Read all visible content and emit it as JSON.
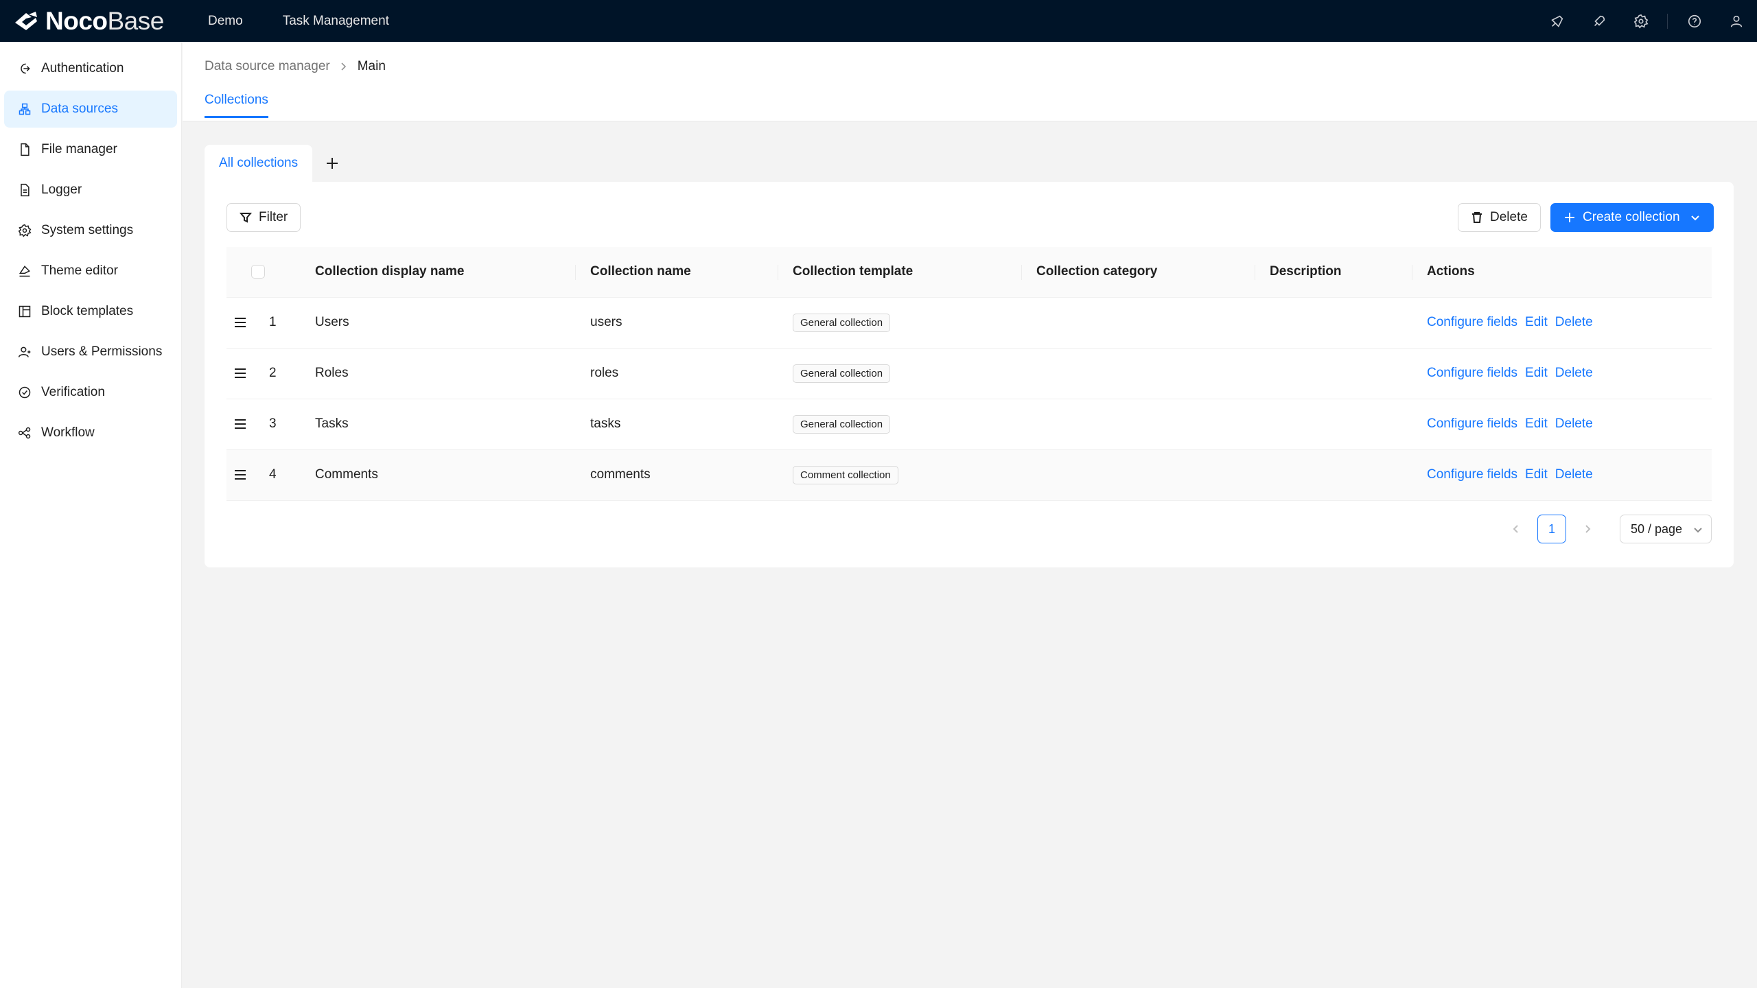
{
  "app": {
    "logo_bold": "Noco",
    "logo_light": "Base",
    "nav": [
      "Demo",
      "Task Management"
    ],
    "top_icons": [
      "brush-icon",
      "rocket-icon",
      "gear-icon",
      "help-icon",
      "user-icon"
    ]
  },
  "sidebar": {
    "items": [
      {
        "label": "Authentication",
        "icon": "login-icon"
      },
      {
        "label": "Data sources",
        "icon": "database-icon",
        "active": true
      },
      {
        "label": "File manager",
        "icon": "file-icon"
      },
      {
        "label": "Logger",
        "icon": "log-file-icon"
      },
      {
        "label": "System settings",
        "icon": "gear-icon"
      },
      {
        "label": "Theme editor",
        "icon": "paint-icon"
      },
      {
        "label": "Block templates",
        "icon": "layout-icon"
      },
      {
        "label": "Users & Permissions",
        "icon": "users-icon"
      },
      {
        "label": "Verification",
        "icon": "check-circle-icon"
      },
      {
        "label": "Workflow",
        "icon": "workflow-icon"
      }
    ]
  },
  "breadcrumb": {
    "parent": "Data source manager",
    "current": "Main"
  },
  "page_tab": "Collections",
  "collection_tabs": {
    "active": "All collections"
  },
  "toolbar": {
    "filter": "Filter",
    "delete": "Delete",
    "create": "Create collection"
  },
  "table": {
    "columns": [
      "Collection display name",
      "Collection name",
      "Collection template",
      "Collection category",
      "Description",
      "Actions"
    ],
    "rows": [
      {
        "index": "1",
        "display_name": "Users",
        "name": "users",
        "template": "General collection",
        "category": "",
        "description": ""
      },
      {
        "index": "2",
        "display_name": "Roles",
        "name": "roles",
        "template": "General collection",
        "category": "",
        "description": ""
      },
      {
        "index": "3",
        "display_name": "Tasks",
        "name": "tasks",
        "template": "General collection",
        "category": "",
        "description": ""
      },
      {
        "index": "4",
        "display_name": "Comments",
        "name": "comments",
        "template": "Comment collection",
        "category": "",
        "description": ""
      }
    ],
    "actions": {
      "configure": "Configure fields",
      "edit": "Edit",
      "delete": "Delete"
    }
  },
  "pagination": {
    "current_page": "1",
    "page_size": "50 / page"
  },
  "colors": {
    "accent": "#1677ff",
    "topbar": "#001428",
    "active_bg": "#e6f4ff"
  }
}
